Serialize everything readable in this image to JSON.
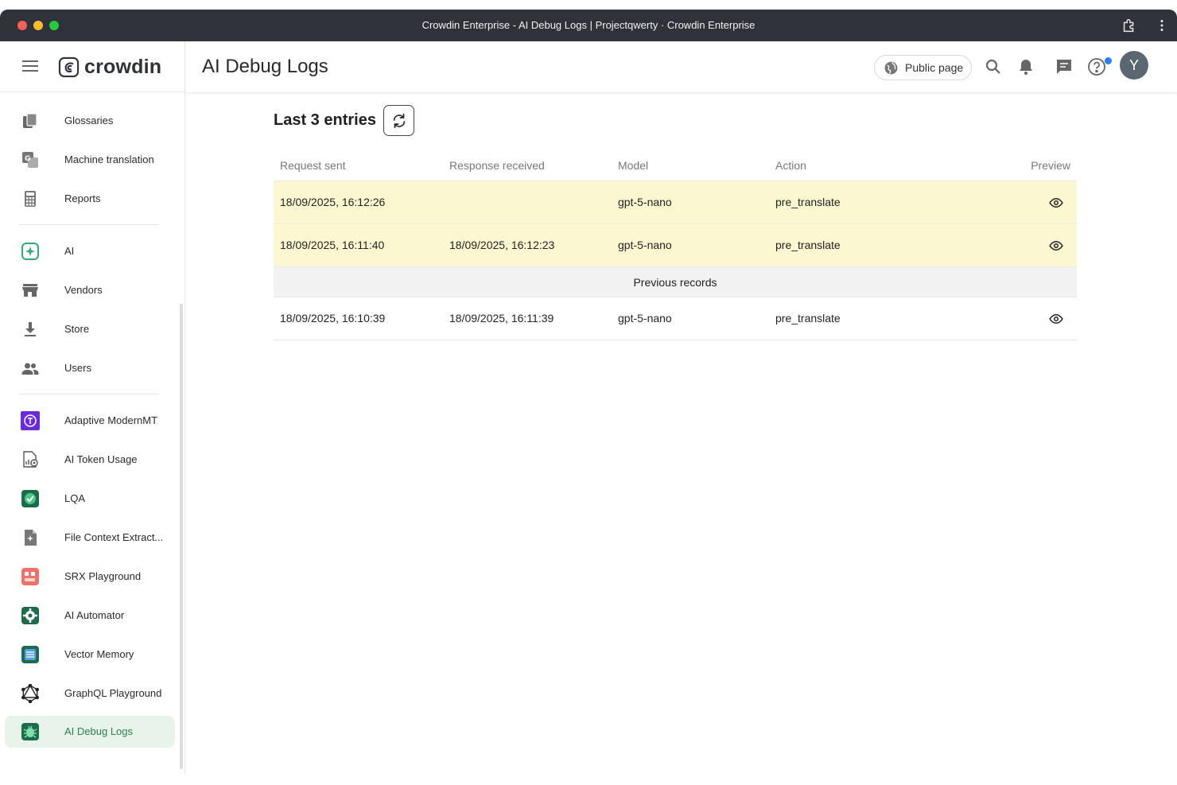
{
  "window": {
    "title": "Crowdin Enterprise - AI Debug Logs | Projectqwerty · Crowdin Enterprise"
  },
  "brand": {
    "logo_text": "crowdin"
  },
  "sidebar": {
    "items": [
      {
        "label": "Glossaries",
        "icon": "glossary-icon"
      },
      {
        "label": "Machine translation",
        "icon": "machine-translation-icon"
      },
      {
        "label": "Reports",
        "icon": "calculator-icon"
      },
      {
        "label": "AI",
        "icon": "ai-sparkle-icon"
      },
      {
        "label": "Vendors",
        "icon": "store-front-icon"
      },
      {
        "label": "Store",
        "icon": "download-icon"
      },
      {
        "label": "Users",
        "icon": "users-icon"
      },
      {
        "label": "Adaptive ModernMT",
        "icon": "modernmt-app-icon"
      },
      {
        "label": "AI Token Usage",
        "icon": "token-usage-icon"
      },
      {
        "label": "LQA",
        "icon": "lqa-app-icon"
      },
      {
        "label": "File Context Extract...",
        "icon": "file-context-icon"
      },
      {
        "label": "SRX Playground",
        "icon": "srx-app-icon"
      },
      {
        "label": "AI Automator",
        "icon": "gear-app-icon"
      },
      {
        "label": "Vector Memory",
        "icon": "vector-memory-icon"
      },
      {
        "label": "GraphQL Playground",
        "icon": "graphql-icon"
      },
      {
        "label": "AI Debug Logs",
        "icon": "bug-app-icon",
        "active": true
      }
    ]
  },
  "header": {
    "page_title": "AI Debug Logs",
    "public_page_label": "Public page",
    "avatar_initial": "Y"
  },
  "main": {
    "entries_title": "Last 3 entries",
    "columns": [
      "Request sent",
      "Response received",
      "Model",
      "Action",
      "Preview"
    ],
    "recent_rows": [
      {
        "request_sent": "18/09/2025, 16:12:26",
        "response_received": "",
        "model": "gpt-5-nano",
        "action": "pre_translate"
      },
      {
        "request_sent": "18/09/2025, 16:11:40",
        "response_received": "18/09/2025, 16:12:23",
        "model": "gpt-5-nano",
        "action": "pre_translate"
      }
    ],
    "previous_label": "Previous records",
    "previous_rows": [
      {
        "request_sent": "18/09/2025, 16:10:39",
        "response_received": "18/09/2025, 16:11:39",
        "model": "gpt-5-nano",
        "action": "pre_translate"
      }
    ]
  },
  "colors": {
    "titlebar": "#2f3238",
    "highlight_row": "#fbf7d0",
    "active_nav": "#e8f4ea",
    "active_text": "#2e7d4f",
    "notification_dot": "#2f80ed"
  }
}
